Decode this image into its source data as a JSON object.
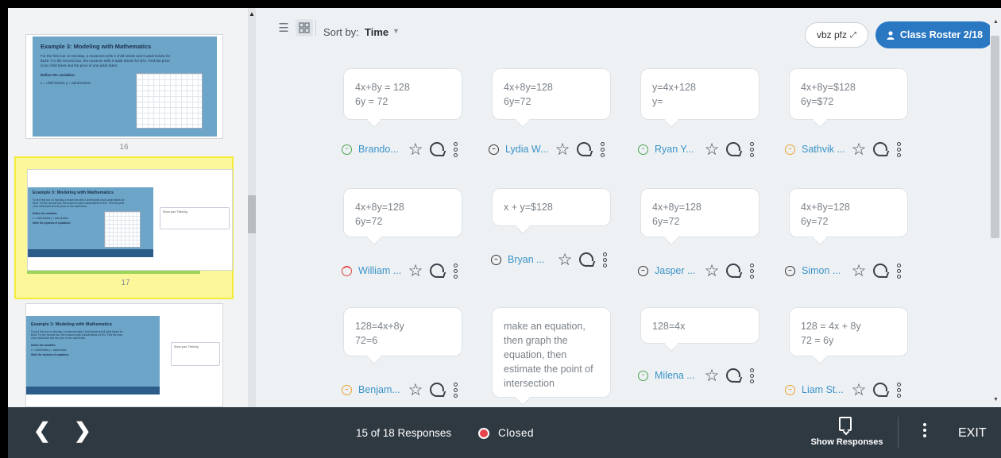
{
  "slides": [
    {
      "number": "16",
      "title": "Example 3: Modeling with Mathematics",
      "problem_lines": [
        "For the first tour on Monday, a museums sells 4 child tickets and 8 adult tickets for",
        "$128. For the second tour, the museum sells 6 adult tickets for $72. Find the price",
        "of an child ticket and the price of one adult ticket."
      ],
      "define": "Define the variables:",
      "vars": "x = child tickets        y = adult tickets"
    },
    {
      "number": "17",
      "title": "Example 3: Modeling with Mathematics",
      "problem_lines": [
        "For the first tour on Monday, a museums sells 4 child tickets and 8 adult tickets for",
        "$128. For the second tour, the museum sells 6 adult tickets for $72. Find the price",
        "of an child ticket and the price of one adult ticket."
      ],
      "define": "Define the variables:",
      "vars": "x = child tickets        y = adult tickets",
      "write": "Write the systems of equations:",
      "note": "Show your Thinking"
    },
    {
      "number": "",
      "title": "Example 3: Modeling with Mathematics",
      "problem_lines": [
        "For the first tour on Monday, a museums sells 4 child tickets and 8 adult tickets for",
        "$128. For the second tour, the museum sells 6 adult tickets for $72. Find the price",
        "of an child ticket and the price of one adult ticket."
      ],
      "define": "Define the variables:",
      "vars": "x = child tickets        y = adult tickets",
      "write": "Write the systems of equations:",
      "note": "Show your Thinking"
    }
  ],
  "toolbar": {
    "list_icon": "list-view-icon",
    "grid_icon": "grid-view-icon",
    "sort_label": "Sort by:",
    "sort_value": "Time",
    "class_code": "vbz pfz",
    "roster_label": "Class Roster 2/18"
  },
  "responses": [
    {
      "lines": [
        "4x+8y = 128",
        "6y = 72"
      ],
      "student": "Brando...",
      "face": "happy"
    },
    {
      "lines": [
        "4x+8y=128",
        "6y=72"
      ],
      "student": "Lydia W...",
      "face": "neutral"
    },
    {
      "lines": [
        "y=4x+128",
        "y="
      ],
      "student": "Ryan Y...",
      "face": "happy"
    },
    {
      "lines": [
        "4x+8y=$128",
        "6y=$72"
      ],
      "student": "Sathvik ...",
      "face": "mid"
    },
    {
      "lines": [
        "4x+8y=128",
        "6y=72"
      ],
      "student": "William ...",
      "face": "sad"
    },
    {
      "lines": [
        "x + y=$128"
      ],
      "student": "Bryan ...",
      "face": "neutral"
    },
    {
      "lines": [
        "4x+8y=128",
        "6y=72"
      ],
      "student": "Jasper ...",
      "face": "neutral"
    },
    {
      "lines": [
        "4x+8y=128",
        "6y=72"
      ],
      "student": "Simon ...",
      "face": "neutral"
    },
    {
      "lines": [
        "128=4x+8y",
        "72=6"
      ],
      "student": "Benjam...",
      "face": "mid"
    },
    {
      "lines": [
        "make an equation,",
        "then graph the",
        "equation, then",
        "estimate the point of",
        "intersection"
      ],
      "student": "",
      "face": ""
    },
    {
      "lines": [
        "128=4x"
      ],
      "student": "Milena ...",
      "face": "happy"
    },
    {
      "lines": [
        "128 = 4x + 8y",
        "72 = 6y"
      ],
      "student": "Liam St...",
      "face": "mid"
    }
  ],
  "footer": {
    "responses": "15 of 18 Responses",
    "status": "Closed",
    "status_color": "#e8434a",
    "show_responses": "Show Responses",
    "exit": "EXIT"
  }
}
